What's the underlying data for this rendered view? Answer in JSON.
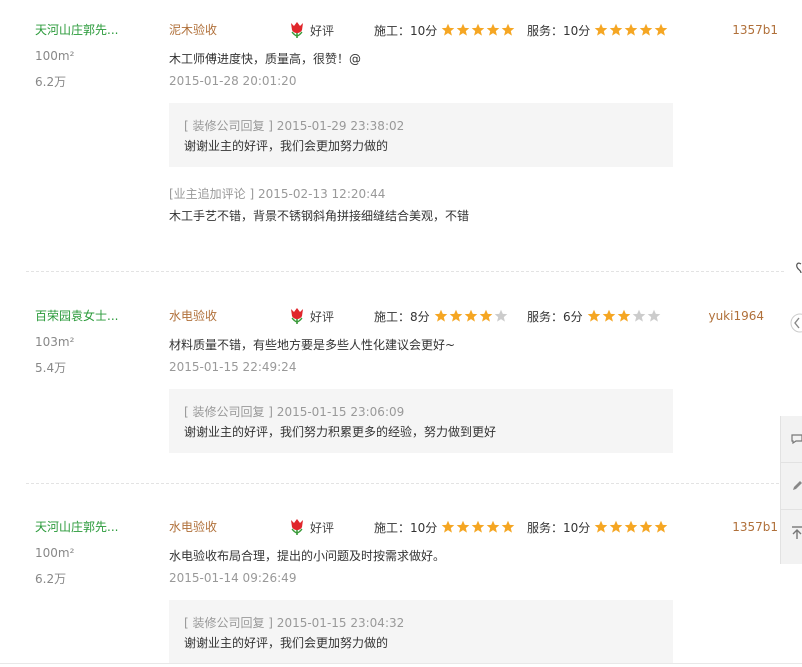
{
  "reviews": [
    {
      "user_name": "天河山庄郭先...",
      "area": "100m²",
      "budget": "6.2万",
      "stage": "泥木验收",
      "rating_label": "好评",
      "construction_label": "施工：10分",
      "construction_stars": 5,
      "service_label": "服务：10分",
      "service_stars": 5,
      "username": "1357b1",
      "text": "木工师傅进度快，质量高，很赞！@",
      "time": "2015-01-28 20:01:20",
      "reply_head": "[ 装修公司回复 ] 2015-01-29 23:38:02",
      "reply_body": "谢谢业主的好评，我们会更加努力做的",
      "followup_head": "[业主追加评论 ] 2015-02-13 12:20:44",
      "followup_body": "木工手艺不错，背景不锈钢斜角拼接细缝结合美观，不错"
    },
    {
      "user_name": "百荣园袁女士...",
      "area": "103m²",
      "budget": "5.4万",
      "stage": "水电验收",
      "rating_label": "好评",
      "construction_label": "施工：8分",
      "construction_stars": 4,
      "service_label": "服务：6分",
      "service_stars": 3,
      "username": "yuki1964",
      "text": "材料质量不错，有些地方要是多些人性化建议会更好~",
      "time": "2015-01-15 22:49:24",
      "reply_head": "[ 装修公司回复 ] 2015-01-15 23:06:09",
      "reply_body": "谢谢业主的好评，我们努力积累更多的经验，努力做到更好"
    },
    {
      "user_name": "天河山庄郭先...",
      "area": "100m²",
      "budget": "6.2万",
      "stage": "水电验收",
      "rating_label": "好评",
      "construction_label": "施工：10分",
      "construction_stars": 5,
      "service_label": "服务：10分",
      "service_stars": 5,
      "username": "1357b1",
      "text": "水电验收布局合理，提出的小问题及时按需求做好。",
      "time": "2015-01-14 09:26:49",
      "reply_head": "[ 装修公司回复 ] 2015-01-15 23:04:32",
      "reply_body": "谢谢业主的好评，我们会更加努力做的"
    }
  ],
  "stars_max": 5,
  "colors": {
    "star_on": "#f5a623",
    "star_off": "#cccccc",
    "user_green": "#2a9a3a",
    "stage_brown": "#b0703a",
    "flower_red": "#e0262b",
    "flower_green": "#3a9a3a"
  },
  "icons": {
    "rating": "tulip-icon",
    "star": "star-icon",
    "side_toolbar": [
      "chat-icon",
      "edit-icon",
      "back-to-top-icon"
    ]
  }
}
